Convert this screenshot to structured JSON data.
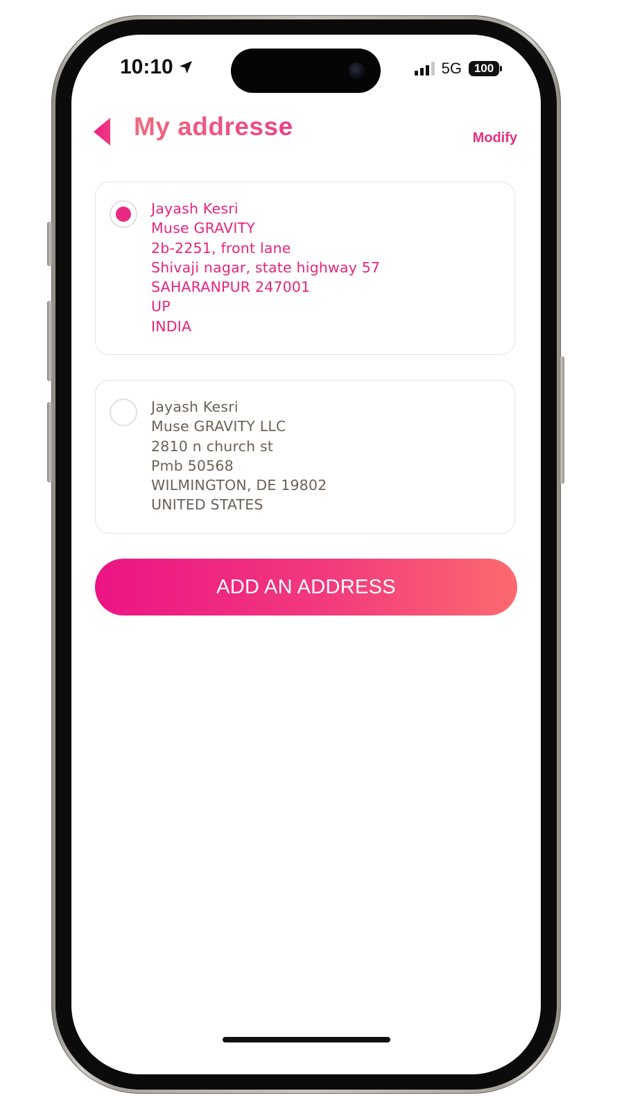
{
  "status_bar": {
    "time": "10:10",
    "network": "5G",
    "battery": "100"
  },
  "header": {
    "title": "My addresse",
    "modify_label": "Modify"
  },
  "addresses": [
    {
      "selected": true,
      "lines": [
        "Jayash Kesri",
        "Muse GRAVITY",
        "2b-2251, front lane",
        "Shivaji nagar, state highway 57",
        "SAHARANPUR 247001",
        "UP",
        "INDIA"
      ]
    },
    {
      "selected": false,
      "lines": [
        "Jayash Kesri",
        "Muse GRAVITY LLC",
        "2810 n church st",
        "Pmb 50568",
        "WILMINGTON, DE 19802",
        "UNITED STATES"
      ]
    }
  ],
  "add_button_label": "ADD AN ADDRESS",
  "colors": {
    "accent": "#e8247c",
    "accent_gradient_start": "#ec1485",
    "accent_gradient_end": "#fc6a6e",
    "secondary_text": "#6a6257"
  },
  "icons": {
    "back": "back-triangle-icon",
    "location": "location-arrow-icon",
    "signal": "cellular-signal-icon",
    "battery": "battery-icon"
  }
}
